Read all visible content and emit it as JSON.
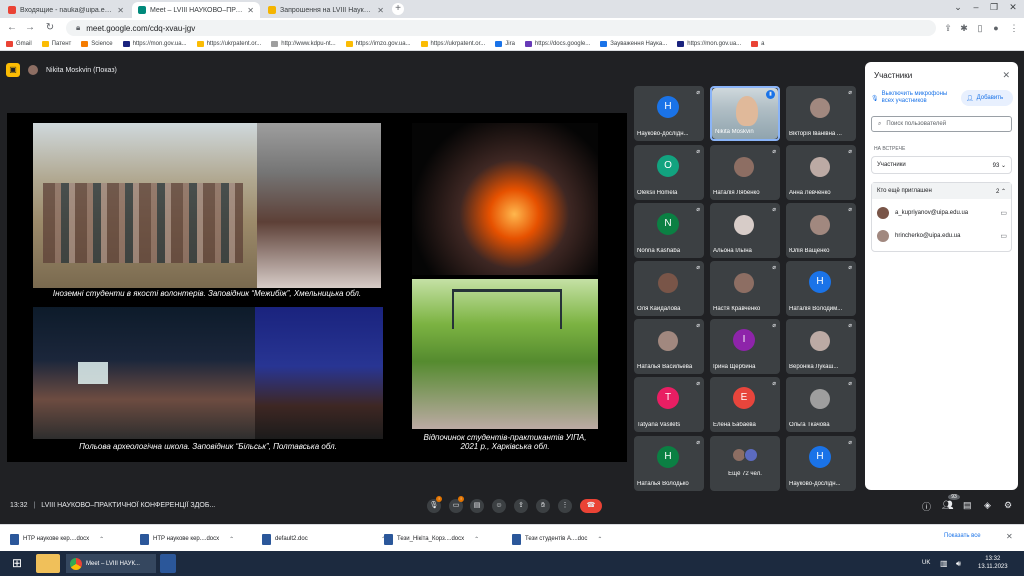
{
  "browser": {
    "tabs": [
      {
        "label": "Входящие - nauka@uipa.edu.ua",
        "favicon_color": "#ea4335",
        "active": false
      },
      {
        "label": "Meet – LVIII НАУКОВО–ПРАКТ",
        "favicon_color": "#00897b",
        "active": true
      },
      {
        "label": "Запрошення на LVIII Науково-п",
        "favicon_color": "#f4b400",
        "active": false
      }
    ],
    "url": "meet.google.com/cdq-xvau-jgv",
    "bookmarks": [
      {
        "label": "Gmail",
        "color": "#ea4335"
      },
      {
        "label": "Патент",
        "color": "#fbbc04"
      },
      {
        "label": "Science",
        "color": "#f57c00"
      },
      {
        "label": "https://mon.gov.ua...",
        "color": "#1a237e"
      },
      {
        "label": "https://ukrpatent.or...",
        "color": "#fbbc04"
      },
      {
        "label": "http://www.kdpu-nt...",
        "color": "#9e9e9e"
      },
      {
        "label": "https://imzo.gov.ua...",
        "color": "#fbbc04"
      },
      {
        "label": "https://ukrpatent.or...",
        "color": "#fbbc04"
      },
      {
        "label": "Jira",
        "color": "#1a73e8"
      },
      {
        "label": "https://docs.google...",
        "color": "#673ab7"
      },
      {
        "label": "Зауваження Наука...",
        "color": "#1a73e8"
      },
      {
        "label": "https://mon.gov.ua...",
        "color": "#1a237e"
      },
      {
        "label": "a",
        "color": "#ea4335"
      }
    ]
  },
  "meet": {
    "presenter_label": "Nikita Moskvin (Показ)",
    "slide": {
      "caption_1": "Іноземні студенти в якості волонтерів. Заповідник “Межибіж”, Хмельницька обл.",
      "caption_2": "Польова археологічна школа. Заповідник “Більськ”, Полтавська обл.",
      "caption_3_line1": "Відпочинок студентів-практикантів УІПА,",
      "caption_3_line2": "2021 р., Харківська обл."
    },
    "tiles": [
      {
        "name": "Науково-дослідн...",
        "initial": "H",
        "color": "#1a73e8",
        "muted": true
      },
      {
        "name": "Nikita Moskvin",
        "initial": "",
        "color": "#5f6368",
        "muted": false,
        "speaking": true,
        "photo": true
      },
      {
        "name": "Вікторія Іванівна ...",
        "initial": "",
        "color": "#a1887f",
        "muted": true,
        "photo": true
      },
      {
        "name": "Oleksii Homela",
        "initial": "O",
        "color": "#12a37f",
        "muted": true
      },
      {
        "name": "Наталія Лябенко",
        "initial": "",
        "color": "#8d6e63",
        "muted": true,
        "photo": true
      },
      {
        "name": "Анна Левченко",
        "initial": "",
        "color": "#bcaaa4",
        "muted": true,
        "photo": true
      },
      {
        "name": "Nonna Kashaba",
        "initial": "N",
        "color": "#0b8043",
        "muted": true
      },
      {
        "name": "Альона Ільїна",
        "initial": "",
        "color": "#d7ccc8",
        "muted": true,
        "photo": true
      },
      {
        "name": "Юлія Ващенко",
        "initial": "",
        "color": "#a1887f",
        "muted": true,
        "photo": true
      },
      {
        "name": "Оля Кайдалова",
        "initial": "",
        "color": "#795548",
        "muted": true,
        "photo": true
      },
      {
        "name": "Настя Кравченко",
        "initial": "",
        "color": "#8d6e63",
        "muted": true,
        "photo": true
      },
      {
        "name": "Наталія Володим...",
        "initial": "H",
        "color": "#1a73e8",
        "muted": true
      },
      {
        "name": "Наталья Васильева",
        "initial": "",
        "color": "#a1887f",
        "muted": true,
        "photo": true
      },
      {
        "name": "Ірина Щербина",
        "initial": "I",
        "color": "#8e24aa",
        "muted": true
      },
      {
        "name": "Вероніка Лукаш...",
        "initial": "",
        "color": "#bcaaa4",
        "muted": true,
        "photo": true
      },
      {
        "name": "Tatyana Vasilets",
        "initial": "T",
        "color": "#e91e63",
        "muted": true
      },
      {
        "name": "Елена Бабаева",
        "initial": "E",
        "color": "#e8453c",
        "muted": true
      },
      {
        "name": "Ольга Ткачова",
        "initial": "",
        "color": "#9e9e9e",
        "muted": true,
        "photo": true
      },
      {
        "name": "Наталья Володько",
        "initial": "H",
        "color": "#0b8043",
        "muted": true
      },
      {
        "name": "Ещё 72 чел.",
        "initial": "",
        "color": "#5f6368",
        "muted": false,
        "more": true
      },
      {
        "name": "Науково-дослідн...",
        "initial": "H",
        "color": "#1a73e8",
        "muted": true
      }
    ],
    "meeting_time": "13:32",
    "meeting_title": "LVIII НАУКОВО–ПРАКТИЧНОЇ КОНФЕРЕНЦІЇ ЗДОБ...",
    "people_count": "93",
    "mic_badge": "!",
    "cam_badge": "!"
  },
  "people_panel": {
    "title": "Участники",
    "mute_all_label": "Выключить микрофоны всех участников",
    "add_label": "Добавить",
    "search_placeholder": "Поиск пользователей",
    "section_label": "НА ВСТРЕЧЕ",
    "participants_label": "Участники",
    "participants_count": "93",
    "invited_label": "Кто ещё приглашен",
    "invited_count": "2",
    "invited": [
      {
        "email": "a_kupriyanov@uipa.edu.ua"
      },
      {
        "email": "hrincherko@uipa.edu.ua"
      }
    ]
  },
  "downloads": {
    "items": [
      {
        "label": "НТР наукове кер....docx"
      },
      {
        "label": "НТР наукове кер....docx"
      },
      {
        "label": "default2.doc"
      },
      {
        "label": "Тези_Нікіта_Корз....docx"
      },
      {
        "label": "Тези студентів А....doc"
      }
    ],
    "show_all": "Показать все"
  },
  "taskbar": {
    "active_app": "Meet – LVIII НАУК...",
    "lang": "UK",
    "time": "13:32",
    "date": "13.11.2023"
  }
}
